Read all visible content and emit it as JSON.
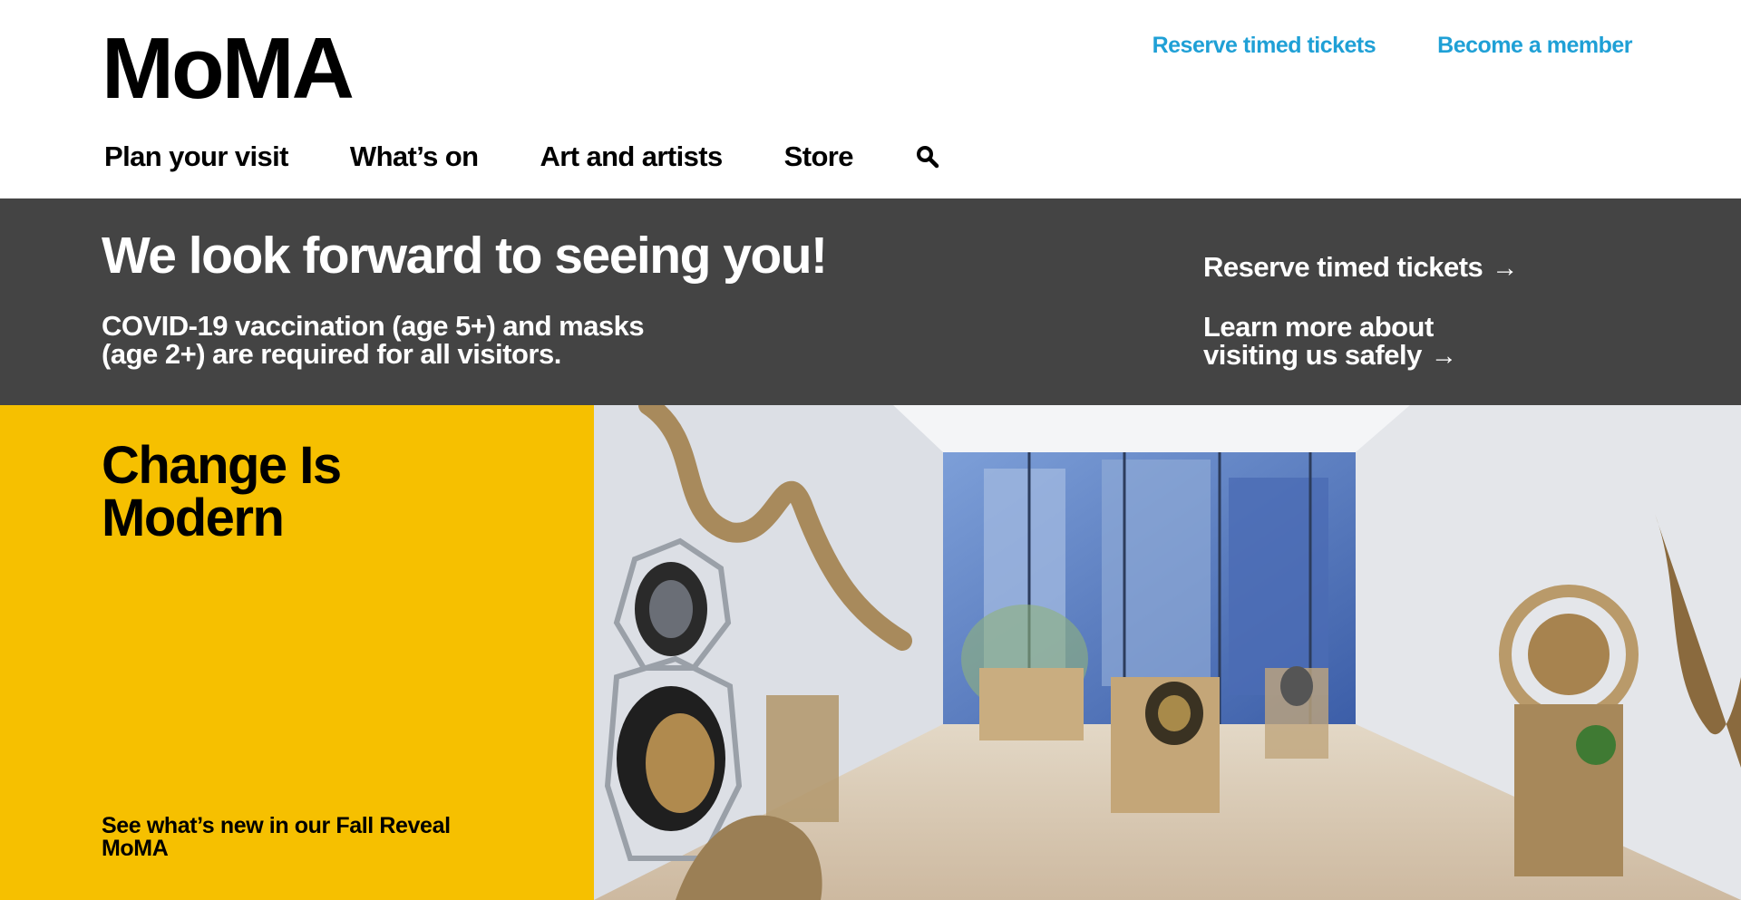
{
  "header": {
    "logo": "MoMA",
    "utility_links": [
      "Reserve timed tickets",
      "Become a member"
    ],
    "nav": [
      "Plan your visit",
      "What’s on",
      "Art and artists",
      "Store"
    ]
  },
  "banner": {
    "title": "We look forward to seeing you!",
    "notice_line1": "COVID-19 vaccination (age 5+) and masks",
    "notice_line2": "(age 2+) are required for all visitors.",
    "link1": "Reserve timed tickets",
    "link2_line1": "Learn more about",
    "link2_line2": "visiting us safely"
  },
  "hero": {
    "title_line1": "Change Is",
    "title_line2": "Modern",
    "cta_line1": "See what’s new in our Fall Reveal",
    "cta_line2": "MoMA"
  },
  "colors": {
    "accent_link": "#1fa0d6",
    "banner_bg": "#444444",
    "hero_yellow": "#f6c000"
  }
}
